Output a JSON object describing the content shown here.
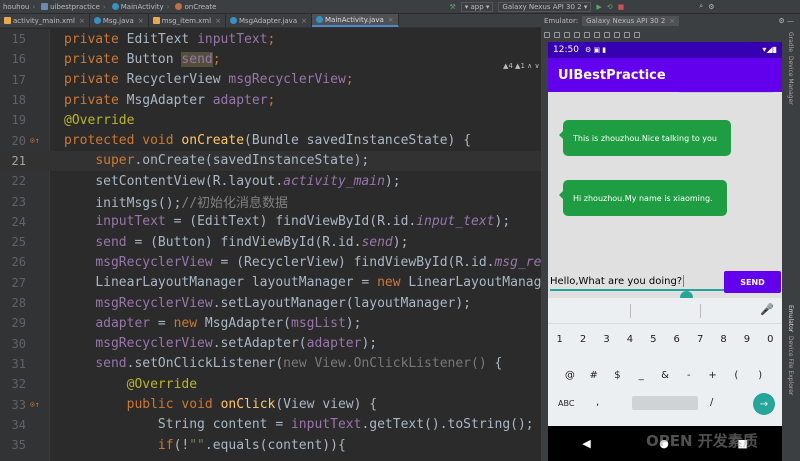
{
  "breadcrumb": [
    "houhou",
    "uibestpractice",
    "MainActivity",
    "onCreate"
  ],
  "run_config": "app",
  "device": "Galaxy Nexus API 30 2",
  "tabs": [
    {
      "label": "activity_main.xml",
      "active": false
    },
    {
      "label": "Msg.java",
      "active": false
    },
    {
      "label": "msg_item.xml",
      "active": false
    },
    {
      "label": "MsgAdapter.java",
      "active": false
    },
    {
      "label": "MainActivity.java",
      "active": true
    }
  ],
  "emulator": {
    "label": "Emulator:",
    "device_tab": "Galaxy Nexus API 30 2"
  },
  "warnings": "▲4 ▲1 ∧ ∨",
  "line_numbers": [
    "15",
    "16",
    "17",
    "18",
    "19",
    "20",
    "21",
    "22",
    "23",
    "24",
    "25",
    "26",
    "27",
    "28",
    "29",
    "30",
    "31",
    "32",
    "33",
    "34",
    "35"
  ],
  "code": {
    "l15": [
      "private",
      "EditText",
      "inputText",
      ";"
    ],
    "l16": [
      "private",
      "Button",
      "send",
      ";"
    ],
    "l17": [
      "private",
      "RecyclerView",
      "msgRecyclerView",
      ";"
    ],
    "l18": [
      "private",
      "MsgAdapter",
      "adapter",
      ";"
    ],
    "l19": "@Override",
    "l20": [
      "protected",
      "void",
      "onCreate",
      "(Bundle savedInstanceState) {"
    ],
    "l21": [
      "super",
      ".onCreate(savedInstanceState);"
    ],
    "l22": [
      "setContentView(R.layout.",
      "activity_main",
      ");"
    ],
    "l23": [
      "initMsgs();",
      "//初始化消息数据"
    ],
    "l24": [
      "inputText",
      " = (EditText) findViewById(R.id.",
      "input_text",
      ");"
    ],
    "l25": [
      "send",
      " = (Button) findViewById(R.id.",
      "send",
      ");"
    ],
    "l26": [
      "msgRecyclerView",
      " = (RecyclerView) findViewById(R.id.",
      "msg_recyc"
    ],
    "l27": [
      "LinearLayoutManager layoutManager = ",
      "new",
      " LinearLayoutManager("
    ],
    "l28": [
      "msgRecyclerView",
      ".setLayoutManager(layoutManager);"
    ],
    "l29": [
      "adapter",
      " = ",
      "new",
      " MsgAdapter(",
      "msgList",
      ");"
    ],
    "l30": [
      "msgRecyclerView",
      ".setAdapter(",
      "adapter",
      ");"
    ],
    "l31": [
      "send",
      ".setOnClickListener(",
      "new View.OnClickListener()",
      " {"
    ],
    "l32": "@Override",
    "l33": [
      "public",
      "void",
      "onClick",
      "(View view) {"
    ],
    "l34": [
      "String content = ",
      "inputText",
      ".getText().toString();"
    ],
    "l35": [
      "if",
      "(!",
      "\"\"",
      ".equals(content)){"
    ]
  },
  "phone": {
    "time": "12:50",
    "app_title": "UIBestPractice",
    "messages": [
      "This is zhouzhou.Nice talking to you",
      "Hi zhouzhou.My name is xiaoming."
    ],
    "input_value": "Hello,What are you doing?",
    "send_label": "SEND",
    "kb_row1": [
      "1",
      "2",
      "3",
      "4",
      "5",
      "6",
      "7",
      "8",
      "9",
      "0"
    ],
    "kb_row2": [
      "@",
      "#",
      "$",
      "_",
      "&",
      "-",
      "+",
      "(",
      ")"
    ],
    "kb_row3": [
      "=\\<",
      "*",
      "\"",
      "'",
      ":",
      ";",
      "!",
      "?",
      "⌫"
    ],
    "kb_row4": [
      "ABC",
      ",",
      "/",
      "→"
    ]
  },
  "right_strip": [
    "Gradle",
    "Device Manager",
    "Emulator",
    "Device File Explorer"
  ],
  "watermark": "OPEN 开发素质",
  "colors": {
    "accent": "#6200ee",
    "dark": "#3700b3",
    "bubble": "#1e9d43",
    "teal": "#26a69a"
  }
}
